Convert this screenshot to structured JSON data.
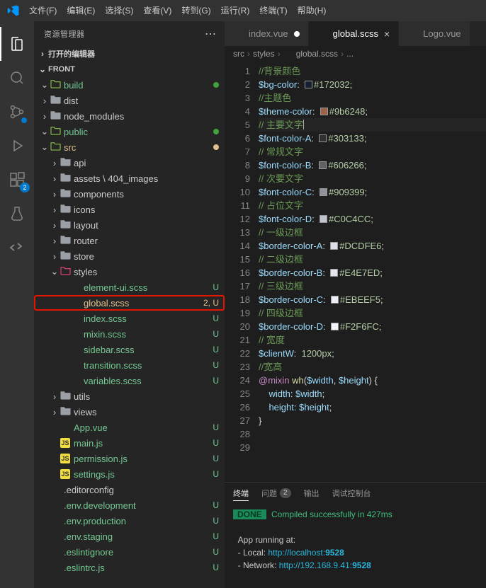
{
  "menu": [
    "文件(F)",
    "编辑(E)",
    "选择(S)",
    "查看(V)",
    "转到(G)",
    "运行(R)",
    "终端(T)",
    "帮助(H)"
  ],
  "activity": {
    "items": [
      {
        "name": "explorer",
        "active": true
      },
      {
        "name": "search"
      },
      {
        "name": "scm",
        "dot": true
      },
      {
        "name": "debug"
      },
      {
        "name": "extensions",
        "badge": "2"
      },
      {
        "name": "testing"
      },
      {
        "name": "remote"
      }
    ]
  },
  "sidebar": {
    "title": "资源管理器",
    "sections": [
      {
        "label": "打开的编辑器",
        "expanded": true
      },
      {
        "label": "FRONT",
        "expanded": true
      }
    ],
    "tree": [
      {
        "d": 0,
        "t": "folder",
        "open": true,
        "label": "build",
        "status": "untracked",
        "color": "#8dc149",
        "dot": "#42a33e"
      },
      {
        "d": 0,
        "t": "folder",
        "open": false,
        "label": "dist",
        "color": "#9aa0a6"
      },
      {
        "d": 0,
        "t": "folder",
        "open": false,
        "label": "node_modules",
        "color": "#9aa0a6"
      },
      {
        "d": 0,
        "t": "folder",
        "open": true,
        "label": "public",
        "status": "untracked",
        "color": "#8dc149",
        "dot": "#42a33e"
      },
      {
        "d": 0,
        "t": "folder",
        "open": true,
        "label": "src",
        "status": "modified",
        "color": "#8dc149",
        "dot": "#e2c08d"
      },
      {
        "d": 1,
        "t": "folder",
        "open": false,
        "label": "api",
        "color": "#9aa0a6"
      },
      {
        "d": 1,
        "t": "folder",
        "open": false,
        "label": "assets \\ 404_images",
        "color": "#9aa0a6"
      },
      {
        "d": 1,
        "t": "folder",
        "open": false,
        "label": "components",
        "color": "#9aa0a6"
      },
      {
        "d": 1,
        "t": "folder",
        "open": false,
        "label": "icons",
        "color": "#9aa0a6"
      },
      {
        "d": 1,
        "t": "folder",
        "open": false,
        "label": "layout",
        "color": "#9aa0a6"
      },
      {
        "d": 1,
        "t": "folder",
        "open": false,
        "label": "router",
        "color": "#9aa0a6"
      },
      {
        "d": 1,
        "t": "folder",
        "open": false,
        "label": "store",
        "color": "#9aa0a6"
      },
      {
        "d": 1,
        "t": "folder",
        "open": true,
        "label": "styles",
        "color": "#ec407a"
      },
      {
        "d": 2,
        "t": "file",
        "kind": "scss",
        "label": "element-ui.scss",
        "status": "untracked",
        "badge": "U"
      },
      {
        "d": 2,
        "t": "file",
        "kind": "scss",
        "label": "global.scss",
        "status": "modified",
        "badge": "2, U",
        "selected": true
      },
      {
        "d": 2,
        "t": "file",
        "kind": "scss",
        "label": "index.scss",
        "status": "untracked",
        "badge": "U"
      },
      {
        "d": 2,
        "t": "file",
        "kind": "scss",
        "label": "mixin.scss",
        "status": "untracked",
        "badge": "U"
      },
      {
        "d": 2,
        "t": "file",
        "kind": "scss",
        "label": "sidebar.scss",
        "status": "untracked",
        "badge": "U"
      },
      {
        "d": 2,
        "t": "file",
        "kind": "scss",
        "label": "transition.scss",
        "status": "untracked",
        "badge": "U"
      },
      {
        "d": 2,
        "t": "file",
        "kind": "scss",
        "label": "variables.scss",
        "status": "untracked",
        "badge": "U"
      },
      {
        "d": 1,
        "t": "folder",
        "open": false,
        "label": "utils",
        "color": "#9aa0a6"
      },
      {
        "d": 1,
        "t": "folder",
        "open": false,
        "label": "views",
        "color": "#9aa0a6"
      },
      {
        "d": 1,
        "t": "file",
        "kind": "vue",
        "label": "App.vue",
        "status": "untracked",
        "badge": "U"
      },
      {
        "d": 1,
        "t": "file",
        "kind": "js",
        "label": "main.js",
        "status": "untracked",
        "badge": "U"
      },
      {
        "d": 1,
        "t": "file",
        "kind": "js",
        "label": "permission.js",
        "status": "untracked",
        "badge": "U"
      },
      {
        "d": 1,
        "t": "file",
        "kind": "js",
        "label": "settings.js",
        "status": "untracked",
        "badge": "U"
      },
      {
        "d": 0,
        "t": "file",
        "kind": "editorconfig",
        "label": ".editorconfig",
        "color": "#e2e2e2"
      },
      {
        "d": 0,
        "t": "file",
        "kind": "env",
        "label": ".env.development",
        "status": "untracked",
        "badge": "U"
      },
      {
        "d": 0,
        "t": "file",
        "kind": "env",
        "label": ".env.production",
        "status": "untracked",
        "badge": "U"
      },
      {
        "d": 0,
        "t": "file",
        "kind": "env",
        "label": ".env.staging",
        "status": "untracked",
        "badge": "U"
      },
      {
        "d": 0,
        "t": "file",
        "kind": "eslint",
        "label": ".eslintignore",
        "status": "untracked",
        "badge": "U"
      },
      {
        "d": 0,
        "t": "file",
        "kind": "eslint",
        "label": ".eslintrc.js",
        "status": "untracked",
        "badge": "U"
      }
    ]
  },
  "tabs": [
    {
      "kind": "vue",
      "label": "index.vue",
      "active": false,
      "dirty": true
    },
    {
      "kind": "scss",
      "label": "global.scss",
      "active": true,
      "closable": true
    },
    {
      "kind": "vue",
      "label": "Logo.vue",
      "active": false
    }
  ],
  "breadcrumbs": [
    "src",
    "styles",
    "global.scss",
    "..."
  ],
  "code": [
    {
      "n": 1,
      "seg": [
        {
          "c": "c-comment",
          "t": "//背景颜色"
        }
      ]
    },
    {
      "n": 2,
      "seg": [
        {
          "c": "c-var",
          "t": "$bg-color"
        },
        {
          "c": "",
          "t": ":  "
        },
        {
          "sw": "#172032"
        },
        {
          "c": "c-num",
          "t": "#172032"
        },
        {
          "c": "",
          "t": ";"
        }
      ]
    },
    {
      "n": 3,
      "seg": [
        {
          "c": "c-comment",
          "t": "//主题色"
        }
      ]
    },
    {
      "n": 4,
      "seg": [
        {
          "c": "c-var",
          "t": "$theme-color"
        },
        {
          "c": "",
          "t": ":  "
        },
        {
          "sw": "#9b6248"
        },
        {
          "c": "c-num",
          "t": "#9b6248"
        },
        {
          "c": "",
          "t": ";"
        }
      ]
    },
    {
      "n": 5,
      "cursor": true,
      "seg": [
        {
          "c": "c-comment",
          "t": "// 主要文字"
        }
      ]
    },
    {
      "n": 6,
      "seg": [
        {
          "c": "c-var",
          "t": "$font-color-A"
        },
        {
          "c": "",
          "t": ":  "
        },
        {
          "sw": "#303133"
        },
        {
          "c": "c-num",
          "t": "#303133"
        },
        {
          "c": "",
          "t": ";"
        }
      ]
    },
    {
      "n": 7,
      "seg": [
        {
          "c": "c-comment",
          "t": "// 常规文字"
        }
      ]
    },
    {
      "n": 8,
      "seg": [
        {
          "c": "c-var",
          "t": "$font-color-B"
        },
        {
          "c": "",
          "t": ":  "
        },
        {
          "sw": "#606266"
        },
        {
          "c": "c-num",
          "t": "#606266"
        },
        {
          "c": "",
          "t": ";"
        }
      ]
    },
    {
      "n": 9,
      "seg": [
        {
          "c": "c-comment",
          "t": "// 次要文字"
        }
      ]
    },
    {
      "n": 10,
      "seg": [
        {
          "c": "c-var",
          "t": "$font-color-C"
        },
        {
          "c": "",
          "t": ":  "
        },
        {
          "sw": "#909399"
        },
        {
          "c": "c-num",
          "t": "#909399"
        },
        {
          "c": "",
          "t": ";"
        }
      ]
    },
    {
      "n": 11,
      "seg": [
        {
          "c": "c-comment",
          "t": "// 占位文字"
        }
      ]
    },
    {
      "n": 12,
      "seg": [
        {
          "c": "c-var",
          "t": "$font-color-D"
        },
        {
          "c": "",
          "t": ":  "
        },
        {
          "sw": "#C0C4CC"
        },
        {
          "c": "c-num",
          "t": "#C0C4CC"
        },
        {
          "c": "",
          "t": ";"
        }
      ]
    },
    {
      "n": 13,
      "seg": [
        {
          "c": "c-comment",
          "t": "// 一级边框"
        }
      ]
    },
    {
      "n": 14,
      "seg": [
        {
          "c": "c-var",
          "t": "$border-color-A"
        },
        {
          "c": "",
          "t": ":  "
        },
        {
          "sw": "#DCDFE6"
        },
        {
          "c": "c-num",
          "t": "#DCDFE6"
        },
        {
          "c": "",
          "t": ";"
        }
      ]
    },
    {
      "n": 15,
      "seg": [
        {
          "c": "c-comment",
          "t": "// 二级边框"
        }
      ]
    },
    {
      "n": 16,
      "seg": [
        {
          "c": "c-var",
          "t": "$border-color-B"
        },
        {
          "c": "",
          "t": ":  "
        },
        {
          "sw": "#E4E7ED"
        },
        {
          "c": "c-num",
          "t": "#E4E7ED"
        },
        {
          "c": "",
          "t": ";"
        }
      ]
    },
    {
      "n": 17,
      "seg": [
        {
          "c": "c-comment",
          "t": "// 三级边框"
        }
      ]
    },
    {
      "n": 18,
      "seg": [
        {
          "c": "c-var",
          "t": "$border-color-C"
        },
        {
          "c": "",
          "t": ":  "
        },
        {
          "sw": "#EBEEF5"
        },
        {
          "c": "c-num",
          "t": "#EBEEF5"
        },
        {
          "c": "",
          "t": ";"
        }
      ]
    },
    {
      "n": 19,
      "seg": [
        {
          "c": "c-comment",
          "t": "// 四级边框"
        }
      ]
    },
    {
      "n": 20,
      "seg": [
        {
          "c": "c-var",
          "t": "$border-color-D"
        },
        {
          "c": "",
          "t": ":  "
        },
        {
          "sw": "#F2F6FC"
        },
        {
          "c": "c-num",
          "t": "#F2F6FC"
        },
        {
          "c": "",
          "t": ";"
        }
      ]
    },
    {
      "n": 21,
      "seg": [
        {
          "c": "c-comment",
          "t": "// 宽度"
        }
      ]
    },
    {
      "n": 22,
      "seg": [
        {
          "c": "c-var",
          "t": "$clientW"
        },
        {
          "c": "",
          "t": ":  "
        },
        {
          "c": "c-num",
          "t": "1200px"
        },
        {
          "c": "",
          "t": ";"
        }
      ]
    },
    {
      "n": 23,
      "seg": [
        {
          "c": "",
          "t": ""
        }
      ]
    },
    {
      "n": 24,
      "seg": [
        {
          "c": "c-comment",
          "t": "//宽高"
        }
      ]
    },
    {
      "n": 25,
      "seg": [
        {
          "c": "c-key",
          "t": "@mixin"
        },
        {
          "c": "",
          "t": " "
        },
        {
          "c": "c-func",
          "t": "wh"
        },
        {
          "c": "",
          "t": "("
        },
        {
          "c": "c-var",
          "t": "$width"
        },
        {
          "c": "",
          "t": ", "
        },
        {
          "c": "c-var",
          "t": "$height"
        },
        {
          "c": "",
          "t": ") {"
        }
      ]
    },
    {
      "n": 26,
      "seg": [
        {
          "c": "",
          "t": "    "
        },
        {
          "c": "c-param",
          "t": "width"
        },
        {
          "c": "",
          "t": ": "
        },
        {
          "c": "c-var",
          "t": "$width"
        },
        {
          "c": "",
          "t": ";"
        }
      ]
    },
    {
      "n": 27,
      "seg": [
        {
          "c": "",
          "t": "    "
        },
        {
          "c": "c-param",
          "t": "height"
        },
        {
          "c": "",
          "t": ": "
        },
        {
          "c": "c-var",
          "t": "$height"
        },
        {
          "c": "",
          "t": ";"
        }
      ]
    },
    {
      "n": 28,
      "seg": [
        {
          "c": "",
          "t": "}"
        }
      ]
    },
    {
      "n": 29,
      "seg": [
        {
          "c": "",
          "t": ""
        }
      ]
    }
  ],
  "panel": {
    "tabs": [
      {
        "label": "终端",
        "active": true
      },
      {
        "label": "问题",
        "badge": "2"
      },
      {
        "label": "输出"
      },
      {
        "label": "调试控制台"
      }
    ],
    "done": "DONE",
    "doneMsg": " Compiled successfully in 427ms",
    "running": "App running at:",
    "local_label": "- Local:   ",
    "local_url": "http://localhost:",
    "local_port": "9528",
    "net_label": "- Network: ",
    "net_url": "http://192.168.9.41:",
    "net_port": "9528"
  }
}
